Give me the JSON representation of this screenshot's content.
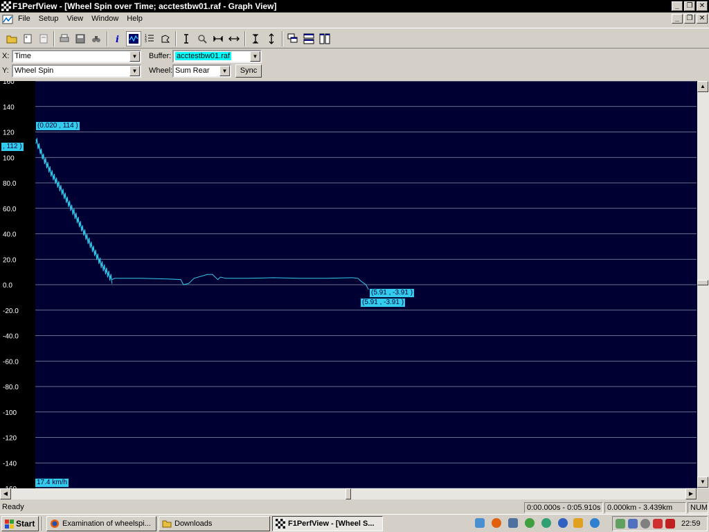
{
  "window": {
    "title": "F1PerfView - [Wheel Spin over Time; acctestbw01.raf - Graph View]"
  },
  "menu": {
    "items": [
      "File",
      "Setup",
      "View",
      "Window",
      "Help"
    ]
  },
  "controls": {
    "x_label": "X:",
    "x_value": "Time",
    "y_label": "Y:",
    "y_value": "Wheel Spin",
    "buffer_label": "Buffer:",
    "buffer_value": "acctestbw01.raf",
    "wheel_label": "Wheel:",
    "wheel_value": "Sum Rear",
    "sync_label": "Sync"
  },
  "graph": {
    "cursor_label_top": "(0.020 , 114 )",
    "cursor_label_left": ", 112 )",
    "cursor_label_end1": "(5.91 , -3.91 )",
    "cursor_label_end2": "(5.91 , -3.91 )",
    "speed_label": "17.4  km/h",
    "series_color": "#33ccee",
    "background_color": "#000033",
    "gridline_color": "#8899aa"
  },
  "chart_data": {
    "type": "line",
    "ylim": [
      -160,
      160
    ],
    "ytick_labels": [
      "160",
      "140",
      "120",
      "100",
      "80.0",
      "60.0",
      "40.0",
      "20.0",
      "0.0",
      "-20.0",
      "-40.0",
      "-60.0",
      "-80.0",
      "-100",
      "-120",
      "-140",
      "-160"
    ],
    "yticks": [
      160,
      140,
      120,
      100,
      80,
      60,
      40,
      20,
      0,
      -20,
      -40,
      -60,
      -80,
      -100,
      -120,
      -140,
      -160
    ],
    "grid": true,
    "xlim": [
      0,
      25
    ],
    "x": [
      0.02,
      0.3,
      0.6,
      1.0,
      1.5,
      2.0,
      2.5,
      2.9,
      3.0,
      3.2,
      4.0,
      5.0,
      5.5,
      5.6,
      5.8,
      6.0,
      6.5,
      6.7,
      6.9,
      7.0,
      7.2,
      8.0,
      9.0,
      10.0,
      11.0,
      12.0,
      12.2,
      12.3,
      12.5,
      12.6
    ],
    "y": [
      114,
      100,
      88,
      74,
      55,
      35,
      16,
      4,
      5,
      5,
      5,
      4.5,
      4,
      0,
      1,
      5,
      8,
      8,
      4,
      6,
      5,
      5,
      5.5,
      5,
      5,
      5.5,
      5,
      3,
      0,
      -3.91
    ],
    "series": [
      {
        "values_ref": "y"
      }
    ],
    "title": "",
    "xlabel": "",
    "ylabel": ""
  },
  "status": {
    "ready": "Ready",
    "time_range": "0:00.000s - 0:05.910s",
    "distance_range": "0.000km - 3.439km",
    "num": "NUM"
  },
  "taskbar": {
    "start": "Start",
    "tasks": [
      "Examination of wheelspi...",
      "Downloads",
      "F1PerfView - [Wheel S..."
    ],
    "clock": "22:59"
  }
}
